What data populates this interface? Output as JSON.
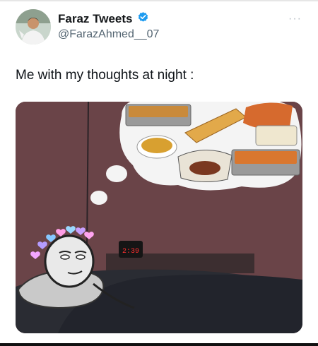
{
  "tweet": {
    "author_name": "Faraz Tweets",
    "handle": "@FarazAhmed__07",
    "more_label": "···",
    "text": "Me with my thoughts at night :"
  },
  "media": {
    "clock_text": "2:39",
    "subject": "meme-stick-figure-in-bed-dreaming-of-food"
  },
  "colors": {
    "verified": "#1d9bf0",
    "handle": "#536471",
    "wall": "#6f474b",
    "blanket": "#22242c"
  }
}
